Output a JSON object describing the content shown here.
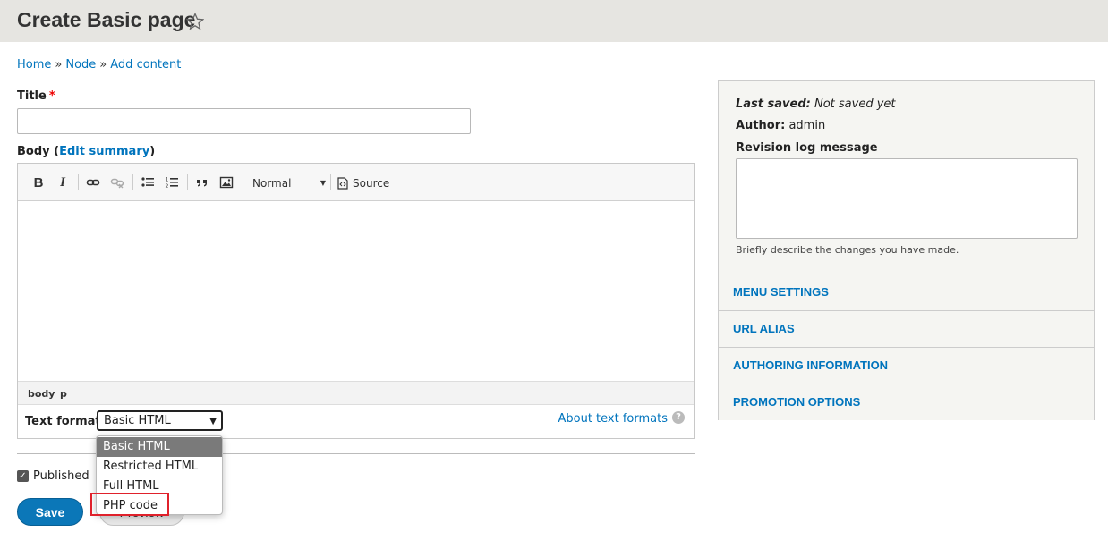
{
  "header": {
    "title": "Create Basic page"
  },
  "breadcrumb": [
    "Home",
    "Node",
    "Add content"
  ],
  "form": {
    "title_label": "Title",
    "required_mark": "*",
    "body_label": "Body",
    "edit_summary": "Edit summary",
    "toolbar": {
      "bold": "B",
      "italic": "I",
      "format_value": "Normal",
      "source_label": "Source"
    },
    "path_bar": [
      "body",
      "p"
    ],
    "text_format_label": "Text format",
    "text_format_selected": "Basic HTML",
    "text_format_options": [
      "Basic HTML",
      "Restricted HTML",
      "Full HTML",
      "PHP code"
    ],
    "about_text_formats": "About text formats",
    "help_glyph": "?",
    "published_label": "Published",
    "save_label": "Save",
    "preview_label": "Preview"
  },
  "sidebar": {
    "last_saved_label": "Last saved:",
    "last_saved_value": "Not saved yet",
    "author_label": "Author:",
    "author_value": "admin",
    "revision_label": "Revision log message",
    "revision_help": "Briefly describe the changes you have made.",
    "sections": [
      "MENU SETTINGS",
      "URL ALIAS",
      "AUTHORING INFORMATION",
      "PROMOTION OPTIONS"
    ]
  },
  "colors": {
    "link": "#0074bd",
    "primary_button": "#0b77b8",
    "highlight": "#e0212b",
    "header_bg": "#e6e5e1"
  },
  "icons": [
    "star-icon",
    "link-icon",
    "unlink-icon",
    "bulleted-list-icon",
    "numbered-list-icon",
    "blockquote-icon",
    "image-icon",
    "source-icon",
    "checkbox-icon",
    "help-icon",
    "dropdown-arrow-icon"
  ]
}
